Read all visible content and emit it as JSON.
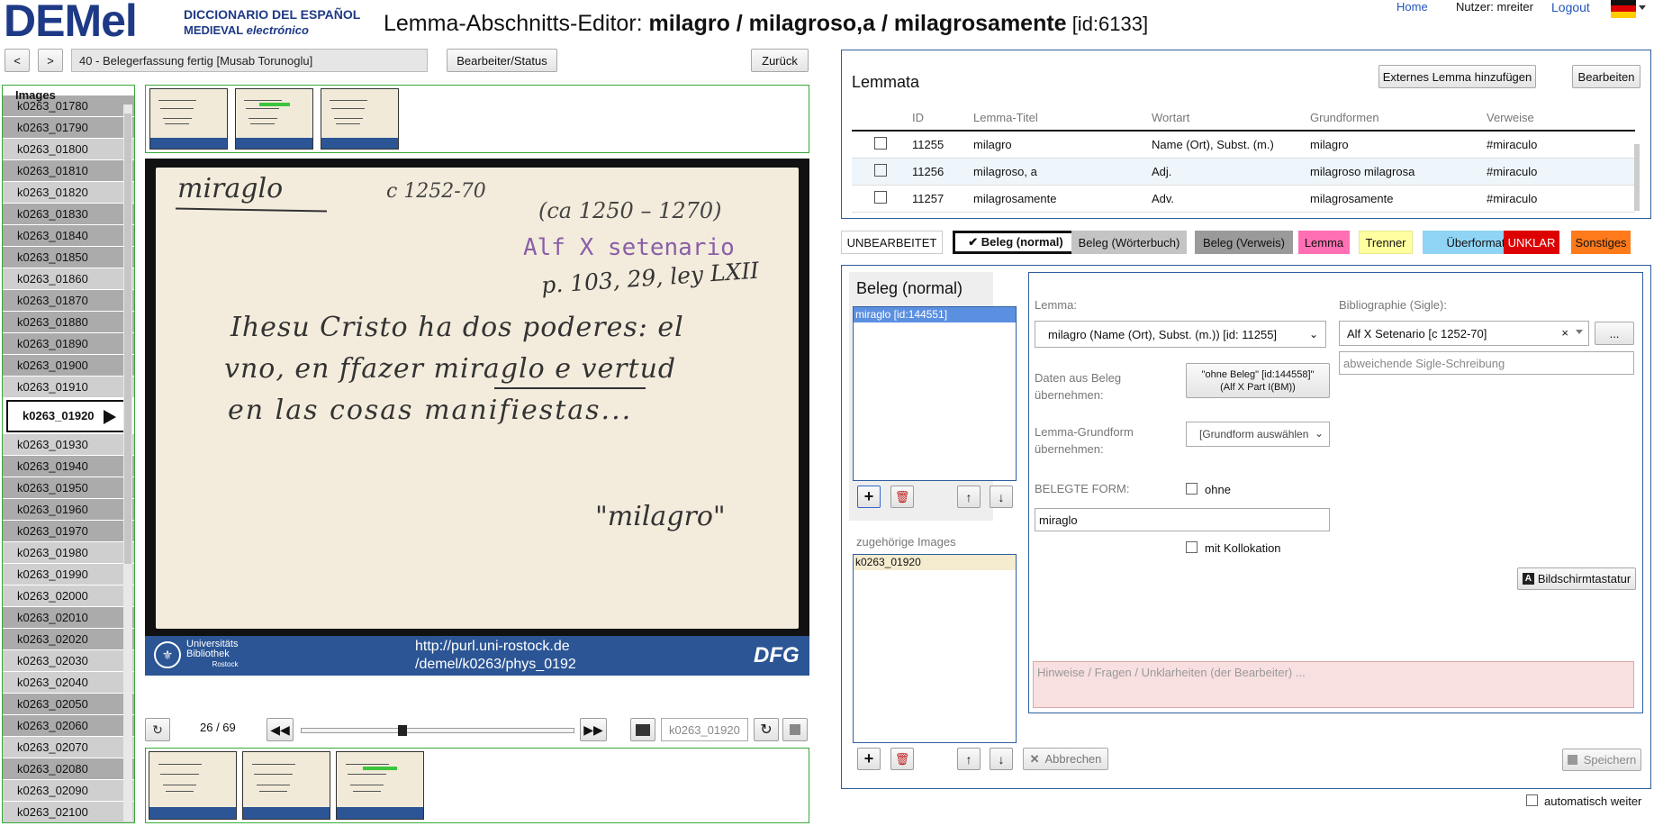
{
  "app": {
    "logo_main": "DEMel",
    "logo_line1": "DICCIONARIO DEL ESPAÑOL",
    "logo_line2_a": "MEDIEVAL ",
    "logo_line2_b": "electrónico",
    "title_prefix": "Lemma-Abschnitts-Editor: ",
    "title_bold": "milagro / milagroso,a / milagrosamente",
    "title_id": " [id:6133]"
  },
  "topnav": {
    "home": "Home",
    "user": "Nutzer: mreiter",
    "logout": "Logout"
  },
  "toolbar": {
    "prev": "<",
    "next": ">",
    "status": "40 - Belegerfassung fertig  [Musab Torunoglu]",
    "editor_status": "Bearbeiter/Status",
    "back": "Zurück"
  },
  "images": {
    "header": "Images",
    "items": [
      {
        "label": "k0263_01780",
        "shade": "g2"
      },
      {
        "label": "k0263_01790",
        "shade": "g2"
      },
      {
        "label": "k0263_01800",
        "shade": "g1"
      },
      {
        "label": "k0263_01810",
        "shade": "g2"
      },
      {
        "label": "k0263_01820",
        "shade": "g1"
      },
      {
        "label": "k0263_01830",
        "shade": "g2"
      },
      {
        "label": "k0263_01840",
        "shade": "g2"
      },
      {
        "label": "k0263_01850",
        "shade": "g2"
      },
      {
        "label": "k0263_01860",
        "shade": "g1"
      },
      {
        "label": "k0263_01870",
        "shade": "g2"
      },
      {
        "label": "k0263_01880",
        "shade": "g2"
      },
      {
        "label": "k0263_01890",
        "shade": "g2"
      },
      {
        "label": "k0263_01900",
        "shade": "g2"
      },
      {
        "label": "k0263_01910",
        "shade": "g1"
      },
      {
        "label": "k0263_01920",
        "shade": "sel"
      },
      {
        "label": "k0263_01930",
        "shade": "g1"
      },
      {
        "label": "k0263_01940",
        "shade": "g2"
      },
      {
        "label": "k0263_01950",
        "shade": "g2"
      },
      {
        "label": "k0263_01960",
        "shade": "g2"
      },
      {
        "label": "k0263_01970",
        "shade": "g2"
      },
      {
        "label": "k0263_01980",
        "shade": "g1"
      },
      {
        "label": "k0263_01990",
        "shade": "g1"
      },
      {
        "label": "k0263_02000",
        "shade": "g1"
      },
      {
        "label": "k0263_02010",
        "shade": "g2"
      },
      {
        "label": "k0263_02020",
        "shade": "g2"
      },
      {
        "label": "k0263_02030",
        "shade": "g1"
      },
      {
        "label": "k0263_02040",
        "shade": "g1"
      },
      {
        "label": "k0263_02050",
        "shade": "g2"
      },
      {
        "label": "k0263_02060",
        "shade": "g2"
      },
      {
        "label": "k0263_02070",
        "shade": "g1"
      },
      {
        "label": "k0263_02080",
        "shade": "g2"
      },
      {
        "label": "k0263_02090",
        "shade": "g1"
      },
      {
        "label": "k0263_02100",
        "shade": "g1"
      }
    ]
  },
  "card": {
    "hw1": "miraglo",
    "hw2": "c 1252-70",
    "hw3": "(ca 1250 – 1270)",
    "stamp": "Alf X setenario",
    "hw4": "p. 103, 29, ley LXII",
    "line1": "Ihesu Cristo ha dos poderes: el",
    "line2": "vno, en ffazer miraglo e vertud",
    "line3": "en las cosas manifiestas...",
    "line4": "\"milagro\"",
    "footer_lib1": "Universitäts",
    "footer_lib2": "Bibliothek",
    "footer_lib3": "Rostock",
    "url1": "http://purl.uni-rostock.de",
    "url2": "/demel/k0263/phys_0192",
    "dfg": "DFG"
  },
  "viewer": {
    "counter": "26 / 69",
    "image_id_value": "k0263_01920",
    "slider_fraction": 0.37
  },
  "lemmata": {
    "title": "Lemmata",
    "add_external": "Externes Lemma hinzufügen",
    "edit": "Bearbeiten",
    "columns": [
      "ID",
      "Lemma-Titel",
      "Wortart",
      "Grundformen",
      "Verweise"
    ],
    "rows": [
      {
        "id": "11255",
        "title": "milagro",
        "pos": "Name (Ort), Subst. (m.)",
        "forms": "milagro",
        "ref": "#miraculo"
      },
      {
        "id": "11256",
        "title": "milagroso, a",
        "pos": "Adj.",
        "forms": "milagroso milagrosa",
        "ref": "#miraculo"
      },
      {
        "id": "11257",
        "title": "milagrosamente",
        "pos": "Adv.",
        "forms": "milagrosamente",
        "ref": "#miraculo"
      }
    ]
  },
  "tags": [
    {
      "label": "UNBEARBEITET",
      "bg": "#ffffff",
      "fg": "#111111",
      "border": "#cccccc"
    },
    {
      "label": "✔ Beleg (normal)",
      "bg": "#ffffff",
      "fg": "#111111",
      "border": "#111111"
    },
    {
      "label": "Beleg (Wörterbuch)",
      "bg": "#c4c4c4",
      "fg": "#111111",
      "border": "#c4c4c4"
    },
    {
      "label": "Beleg (Verweis)",
      "bg": "#9a9a9a",
      "fg": "#111111",
      "border": "#9a9a9a"
    },
    {
      "label": "Lemma",
      "bg": "#ff6fb4",
      "fg": "#111111",
      "border": "#ff6fb4"
    },
    {
      "label": "Trenner",
      "bg": "#ffffa0",
      "fg": "#111111",
      "border": "#e8e890"
    },
    {
      "label": "Überformat",
      "bg": "#8fd4f5",
      "fg": "#111111",
      "border": "#8fd4f5"
    },
    {
      "label": "UNKLAR",
      "bg": "#dd0000",
      "fg": "#ffffff",
      "border": "#dd0000"
    },
    {
      "label": "Sonstiges",
      "bg": "#ff7a1a",
      "fg": "#111111",
      "border": "#ff7a1a"
    }
  ],
  "beleg": {
    "title": "Beleg (normal)",
    "selected_item": "miraglo [id:144551]",
    "images_label": "zugehörige Images",
    "image_item": "k0263_01920",
    "lemma_label": "Lemma:",
    "lemma_value": "milagro (Name (Ort), Subst. (m.)) [id: 11255]",
    "daten_label": "Daten aus Beleg übernehmen:",
    "daten_button_line1": "\"ohne Beleg\" [id:144558]\"",
    "daten_button_line2": "(Alf X Part I(BM))",
    "grundform_label": "Lemma-Grundform übernehmen:",
    "grundform_value": "[Grundform auswählen",
    "belegte_label": "BELEGTE FORM:",
    "ohne_label": "ohne",
    "belegte_value": "miraglo",
    "kollokation_label": "mit Kollokation",
    "biblio_label": "Bibliographie (Sigle):",
    "biblio_value": "Alf X Setenario [c 1252-70]",
    "biblio_more": "...",
    "sigle_placeholder": "abweichende Sigle-Schreibung",
    "keyboard_label": "Bildschirmtastatur",
    "hints_placeholder": "Hinweise / Fragen / Unklarheiten (der Bearbeiter) ...",
    "cancel_label": "Abbrechen",
    "save_label": "Speichern",
    "auto_next_label": "automatisch weiter"
  }
}
